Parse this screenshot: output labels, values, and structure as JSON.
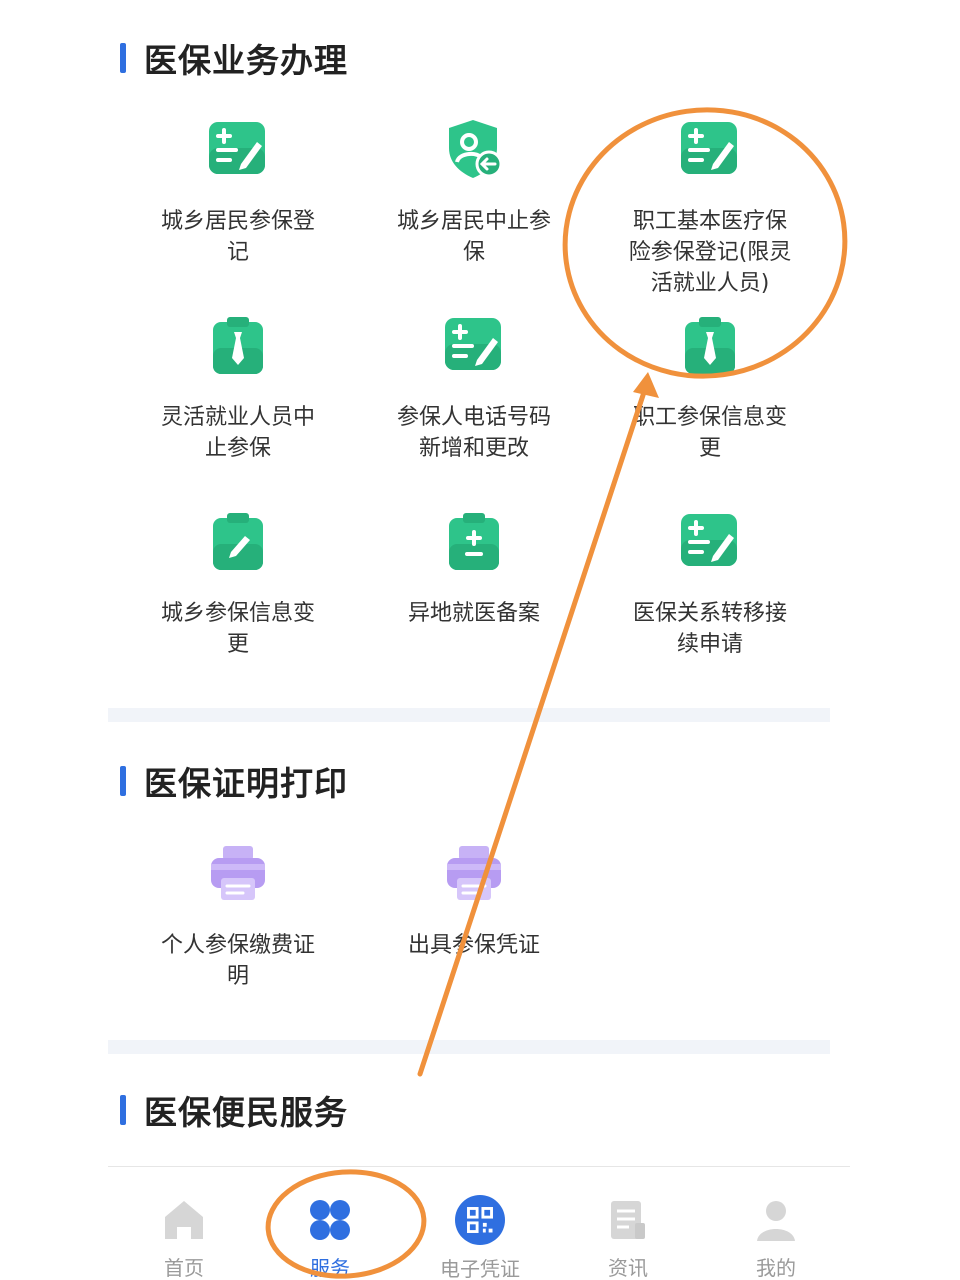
{
  "sections": [
    {
      "title": "医保业务办理",
      "items": [
        {
          "label": "城乡居民参保登记",
          "icon": "add-form-icon"
        },
        {
          "label": "城乡居民中止参保",
          "icon": "user-shield-back-icon"
        },
        {
          "label": "职工基本医疗保险参保登记(限灵活就业人员)",
          "icon": "add-form-icon"
        },
        {
          "label": "灵活就业人员中止参保",
          "icon": "clipboard-tie-icon"
        },
        {
          "label": "参保人电话号码新增和更改",
          "icon": "add-form-icon"
        },
        {
          "label": "职工参保信息变更",
          "icon": "clipboard-tie-icon"
        },
        {
          "label": "城乡参保信息变更",
          "icon": "clipboard-pen-icon"
        },
        {
          "label": "异地就医备案",
          "icon": "clipboard-plus-minus-icon"
        },
        {
          "label": "医保关系转移接续申请",
          "icon": "add-form-icon"
        }
      ]
    },
    {
      "title": "医保证明打印",
      "items": [
        {
          "label": "个人参保缴费证明",
          "icon": "printer-icon"
        },
        {
          "label": "出具参保凭证",
          "icon": "printer-icon"
        }
      ]
    },
    {
      "title": "医保便民服务",
      "items": []
    }
  ],
  "tabbar": [
    {
      "label": "首页",
      "icon": "home-icon",
      "active": false
    },
    {
      "label": "服务",
      "icon": "grid-service-icon",
      "active": true
    },
    {
      "label": "电子凭证",
      "icon": "qr-code-icon",
      "active": false
    },
    {
      "label": "资讯",
      "icon": "news-icon",
      "active": false
    },
    {
      "label": "我的",
      "icon": "user-icon",
      "active": false
    }
  ],
  "colors": {
    "accent": "#2f6fe0",
    "icon_green": "#2ec48a",
    "icon_purple": "#b79cf2",
    "annotation": "#f0913c",
    "inactive_tab": "#9a9a9a"
  }
}
